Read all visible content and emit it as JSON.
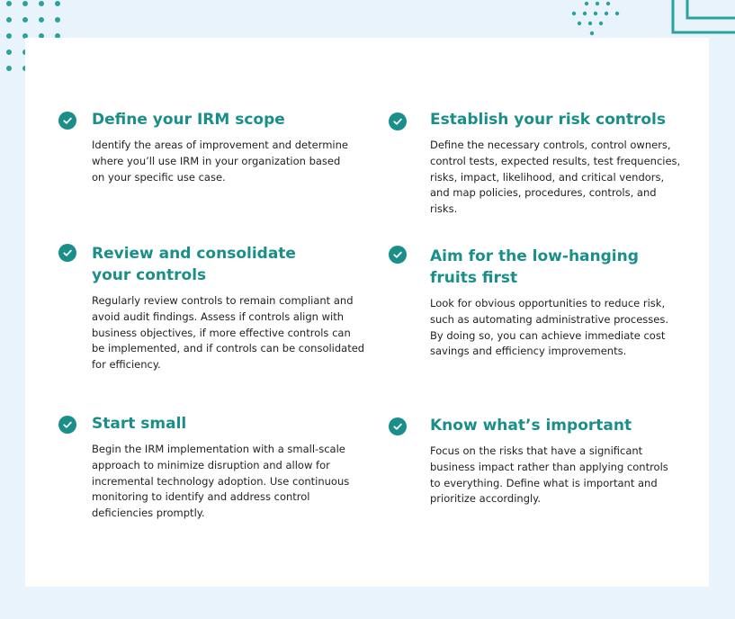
{
  "colors": {
    "accent": "#1a8f8a",
    "background": "#e9f3fc",
    "card": "#ffffff",
    "body_text": "#222222"
  },
  "items": [
    {
      "title": "Define your IRM scope",
      "description": "Identify the areas of improvement and determine where you’ll use IRM in your organization based on your specific use case."
    },
    {
      "title": "Establish your risk controls",
      "description": "Define the necessary controls, control owners, control tests, expected results, test frequencies, risks, impact, likelihood, and critical vendors, and map policies, procedures, controls, and risks."
    },
    {
      "title": "Review and consolidate your controls",
      "description": "Regularly review controls to remain compliant and avoid audit findings. Assess if controls align with business objectives, if more effective controls can be implemented, and if controls can be consolidated for efficiency."
    },
    {
      "title": "Aim for the low-hanging fruits first",
      "description": "Look for obvious opportunities to reduce risk, such as automating administrative processes. By doing so, you can achieve immediate cost savings and efficiency improvements."
    },
    {
      "title": "Start small",
      "description": "Begin the IRM implementation with a small-scale approach to minimize disruption and allow for incremental technology adoption. Use continuous monitoring to identify and address control deficiencies promptly."
    },
    {
      "title": "Know what’s important",
      "description": "Focus on the risks that have a significant business impact rather than applying controls to everything. Define what is important and prioritize accordingly."
    }
  ]
}
